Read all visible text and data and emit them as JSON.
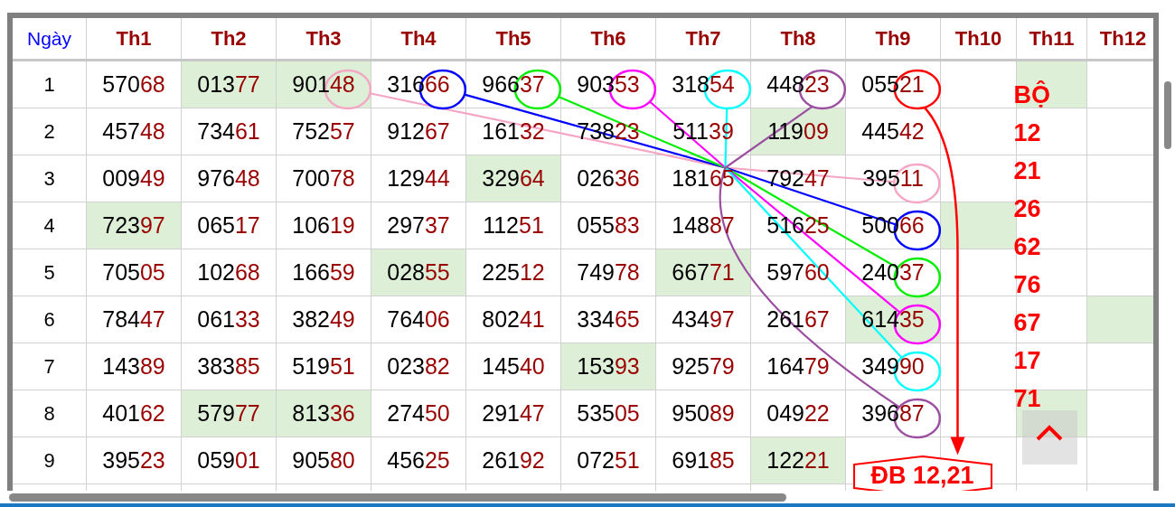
{
  "table": {
    "day_column": "Ngày",
    "columns": [
      "Th1",
      "Th2",
      "Th3",
      "Th4",
      "Th5",
      "Th6",
      "Th7",
      "Th8",
      "Th9",
      "Th10",
      "Th11",
      "Th12"
    ],
    "rows": [
      {
        "day": "1",
        "cells": [
          {
            "value": "57068",
            "highlighted": false
          },
          {
            "value": "01377",
            "highlighted": true
          },
          {
            "value": "90148",
            "highlighted": true
          },
          {
            "value": "31666",
            "highlighted": false
          },
          {
            "value": "96637",
            "highlighted": false
          },
          {
            "value": "90353",
            "highlighted": false
          },
          {
            "value": "31854",
            "highlighted": false
          },
          {
            "value": "44823",
            "highlighted": false
          },
          {
            "value": "05521",
            "highlighted": false
          },
          {
            "highlighted": false
          },
          {
            "highlighted": true
          },
          {
            "highlighted": false
          }
        ]
      },
      {
        "day": "2",
        "cells": [
          {
            "value": "45748",
            "highlighted": false
          },
          {
            "value": "73461",
            "highlighted": false
          },
          {
            "value": "75257",
            "highlighted": false
          },
          {
            "value": "91267",
            "highlighted": false
          },
          {
            "value": "16132",
            "highlighted": false
          },
          {
            "value": "73823",
            "highlighted": false
          },
          {
            "value": "51139",
            "highlighted": false
          },
          {
            "value": "11909",
            "highlighted": true
          },
          {
            "value": "44542",
            "highlighted": false
          },
          {
            "highlighted": false
          },
          {
            "highlighted": false
          },
          {
            "highlighted": false
          }
        ]
      },
      {
        "day": "3",
        "cells": [
          {
            "value": "00949",
            "highlighted": false
          },
          {
            "value": "97648",
            "highlighted": false
          },
          {
            "value": "70078",
            "highlighted": false
          },
          {
            "value": "12944",
            "highlighted": false
          },
          {
            "value": "32964",
            "highlighted": true
          },
          {
            "value": "02636",
            "highlighted": false
          },
          {
            "value": "18165",
            "highlighted": false
          },
          {
            "value": "79247",
            "highlighted": false
          },
          {
            "value": "39511",
            "highlighted": false
          },
          {
            "highlighted": false
          },
          {
            "highlighted": false
          },
          {
            "highlighted": false
          }
        ]
      },
      {
        "day": "4",
        "cells": [
          {
            "value": "72397",
            "highlighted": true
          },
          {
            "value": "06517",
            "highlighted": false
          },
          {
            "value": "10619",
            "highlighted": false
          },
          {
            "value": "29737",
            "highlighted": false
          },
          {
            "value": "11251",
            "highlighted": false
          },
          {
            "value": "05583",
            "highlighted": false
          },
          {
            "value": "14887",
            "highlighted": false
          },
          {
            "value": "51625",
            "highlighted": false
          },
          {
            "value": "50066",
            "highlighted": false
          },
          {
            "highlighted": true
          },
          {
            "highlighted": false
          },
          {
            "highlighted": false
          }
        ]
      },
      {
        "day": "5",
        "cells": [
          {
            "value": "70505",
            "highlighted": false
          },
          {
            "value": "10268",
            "highlighted": false
          },
          {
            "value": "16659",
            "highlighted": false
          },
          {
            "value": "02855",
            "highlighted": true
          },
          {
            "value": "22512",
            "highlighted": false
          },
          {
            "value": "74978",
            "highlighted": false
          },
          {
            "value": "66771",
            "highlighted": true
          },
          {
            "value": "59760",
            "highlighted": false
          },
          {
            "value": "24037",
            "highlighted": false
          },
          {
            "highlighted": false
          },
          {
            "highlighted": false
          },
          {
            "highlighted": false
          }
        ]
      },
      {
        "day": "6",
        "cells": [
          {
            "value": "78447",
            "highlighted": false
          },
          {
            "value": "06133",
            "highlighted": false
          },
          {
            "value": "38249",
            "highlighted": false
          },
          {
            "value": "76406",
            "highlighted": false
          },
          {
            "value": "80241",
            "highlighted": false
          },
          {
            "value": "33465",
            "highlighted": false
          },
          {
            "value": "43497",
            "highlighted": false
          },
          {
            "value": "26167",
            "highlighted": false
          },
          {
            "value": "61435",
            "highlighted": true
          },
          {
            "highlighted": false
          },
          {
            "highlighted": false
          },
          {
            "highlighted": true
          }
        ]
      },
      {
        "day": "7",
        "cells": [
          {
            "value": "14389",
            "highlighted": false
          },
          {
            "value": "38385",
            "highlighted": false
          },
          {
            "value": "51951",
            "highlighted": false
          },
          {
            "value": "02382",
            "highlighted": false
          },
          {
            "value": "14540",
            "highlighted": false
          },
          {
            "value": "15393",
            "highlighted": true
          },
          {
            "value": "92579",
            "highlighted": false
          },
          {
            "value": "16479",
            "highlighted": false
          },
          {
            "value": "34990",
            "highlighted": false
          },
          {
            "highlighted": false
          },
          {
            "highlighted": false
          },
          {
            "highlighted": false
          }
        ]
      },
      {
        "day": "8",
        "cells": [
          {
            "value": "40162",
            "highlighted": false
          },
          {
            "value": "57977",
            "highlighted": true
          },
          {
            "value": "81336",
            "highlighted": true
          },
          {
            "value": "27450",
            "highlighted": false
          },
          {
            "value": "29147",
            "highlighted": false
          },
          {
            "value": "53505",
            "highlighted": false
          },
          {
            "value": "95089",
            "highlighted": false
          },
          {
            "value": "04922",
            "highlighted": false
          },
          {
            "value": "39687",
            "highlighted": false
          },
          {
            "highlighted": false
          },
          {
            "highlighted": true
          },
          {
            "highlighted": false
          }
        ]
      },
      {
        "day": "9",
        "cells": [
          {
            "value": "39523",
            "highlighted": false
          },
          {
            "value": "05901",
            "highlighted": false
          },
          {
            "value": "90580",
            "highlighted": false
          },
          {
            "value": "45625",
            "highlighted": false
          },
          {
            "value": "26192",
            "highlighted": false
          },
          {
            "value": "07251",
            "highlighted": false
          },
          {
            "value": "69185",
            "highlighted": false
          },
          {
            "value": "12221",
            "highlighted": true
          },
          {
            "highlighted": false
          },
          {
            "highlighted": false
          },
          {
            "highlighted": false
          },
          {
            "highlighted": false
          }
        ]
      }
    ]
  },
  "annotations": [
    {
      "color": "#f4a6c4"
    },
    {
      "color": "#0000ff"
    },
    {
      "color": "#00ee00"
    },
    {
      "color": "#ff00ff"
    },
    {
      "color": "#00ffff"
    },
    {
      "color": "#9b4fa0"
    }
  ],
  "set": {
    "title": "BỘ",
    "numbers": [
      "12",
      "21",
      "26",
      "62",
      "76",
      "67",
      "17",
      "71"
    ]
  },
  "special": {
    "label": "ĐB 12,21"
  }
}
